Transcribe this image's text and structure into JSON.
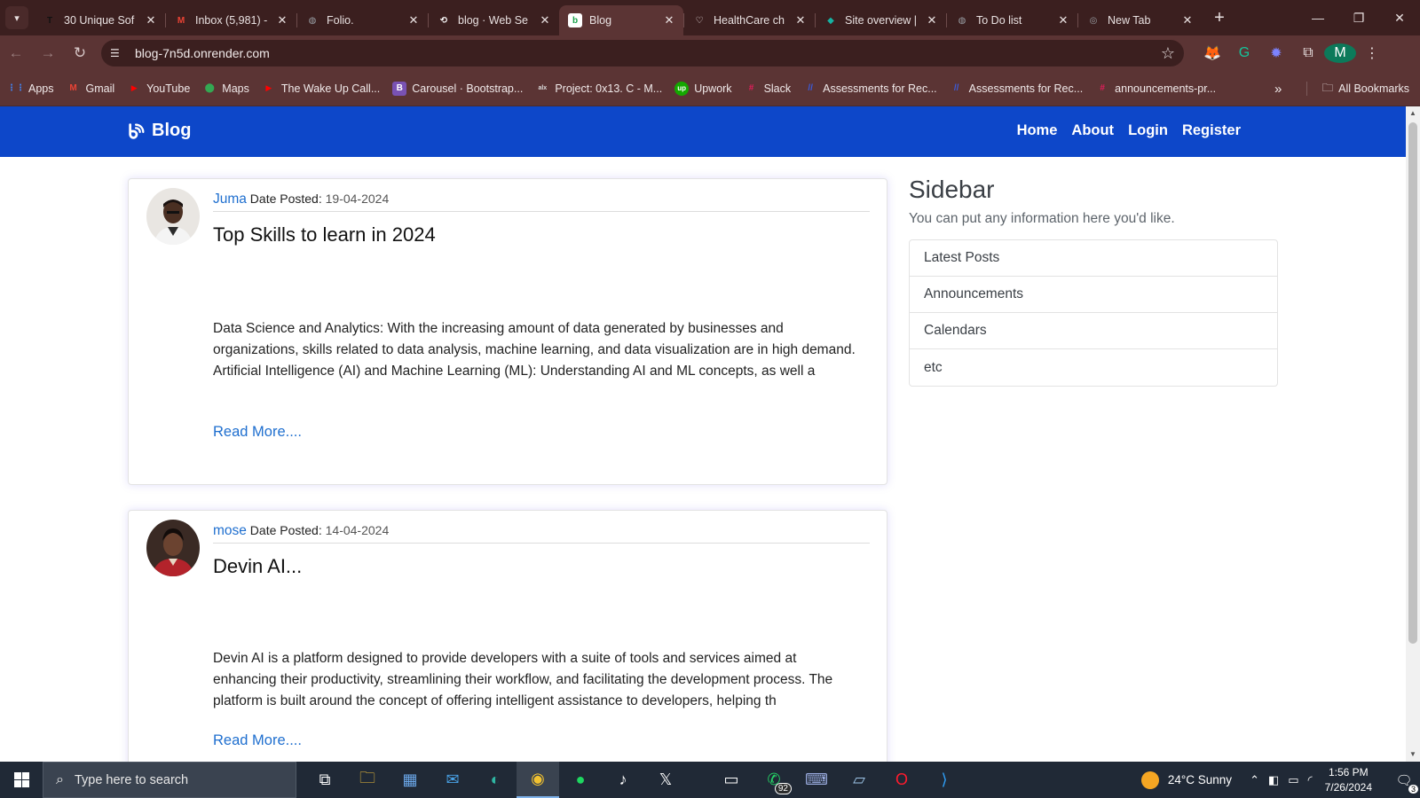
{
  "browser": {
    "tabs": [
      {
        "title": "30 Unique Sof",
        "favicon": "T",
        "fav_color": "#111111"
      },
      {
        "title": "Inbox (5,981) -",
        "favicon": "M",
        "fav_color": "#ea4335"
      },
      {
        "title": "Folio.",
        "favicon": "globe",
        "fav_color": "#9aa0a6"
      },
      {
        "title": "blog · Web Se",
        "favicon": "render",
        "fav_color": "#ffffff"
      },
      {
        "title": "Blog",
        "favicon": "blog",
        "fav_color": "#1aa14a"
      },
      {
        "title": "HealthCare ch",
        "favicon": "heart",
        "fav_color": "#e9e1e1"
      },
      {
        "title": "Site overview |",
        "favicon": "diamond",
        "fav_color": "#16b3a3"
      },
      {
        "title": "To Do list",
        "favicon": "globe",
        "fav_color": "#9aa0a6"
      },
      {
        "title": "New Tab",
        "favicon": "chrome",
        "fav_color": "#9aa0a6"
      }
    ],
    "active_tab_index": 4,
    "url": "blog-7n5d.onrender.com",
    "profile_initial": "M",
    "bookmarks": [
      {
        "label": "Apps",
        "icon": "apps-grid-icon",
        "color": "#4285f4"
      },
      {
        "label": "Gmail",
        "icon": "gmail-icon",
        "color": "#ea4335"
      },
      {
        "label": "YouTube",
        "icon": "youtube-icon",
        "color": "#ff0000"
      },
      {
        "label": "Maps",
        "icon": "maps-icon",
        "color": "#34a853"
      },
      {
        "label": "The Wake Up Call...",
        "icon": "youtube-icon",
        "color": "#ff0000"
      },
      {
        "label": "Carousel · Bootstrap...",
        "icon": "bootstrap-icon",
        "color": "#7952b3"
      },
      {
        "label": "Project: 0x13. C - M...",
        "icon": "alx-icon",
        "color": "#222222"
      },
      {
        "label": "Upwork",
        "icon": "upwork-icon",
        "color": "#14a800"
      },
      {
        "label": "Slack",
        "icon": "slack-icon",
        "color": "#e01e5a"
      },
      {
        "label": "Assessments for Rec...",
        "icon": "assessment-icon",
        "color": "#3b5bdb"
      },
      {
        "label": "Assessments for Rec...",
        "icon": "assessment-icon",
        "color": "#3b5bdb"
      },
      {
        "label": "announcements-pr...",
        "icon": "slack-icon",
        "color": "#e01e5a"
      }
    ],
    "all_bookmarks_label": "All Bookmarks"
  },
  "site": {
    "brand": "Blog",
    "nav": [
      "Home",
      "About",
      "Login",
      "Register"
    ],
    "accent": "#0d47c9"
  },
  "posts": [
    {
      "author": "Juma",
      "date_label": "Date Posted:",
      "date": "19-04-2024",
      "title": "Top Skills to learn in 2024",
      "excerpt": "Data Science and Analytics: With the increasing amount of data generated by businesses and organizations, skills related to data analysis, machine learning, and data visualization are in high demand.\nArtificial Intelligence (AI) and Machine Learning (ML): Understanding AI and ML concepts, as well a",
      "read_more": "Read More...."
    },
    {
      "author": "mose",
      "date_label": "Date Posted:",
      "date": "14-04-2024",
      "title": "Devin AI...",
      "excerpt": "Devin AI is a platform designed to provide developers with a suite of tools and services aimed at enhancing their productivity, streamlining their workflow, and facilitating the development process. The platform is built around the concept of offering intelligent assistance to developers, helping th",
      "read_more": "Read More...."
    }
  ],
  "sidebar": {
    "title": "Sidebar",
    "subtitle": "You can put any information here you'd like.",
    "items": [
      "Latest Posts",
      "Announcements",
      "Calendars",
      "etc"
    ]
  },
  "taskbar": {
    "search_placeholder": "Type here to search",
    "whatsapp_badge": "92",
    "weather": "24°C  Sunny",
    "time": "1:56 PM",
    "date": "7/26/2024",
    "notifications": "3"
  }
}
